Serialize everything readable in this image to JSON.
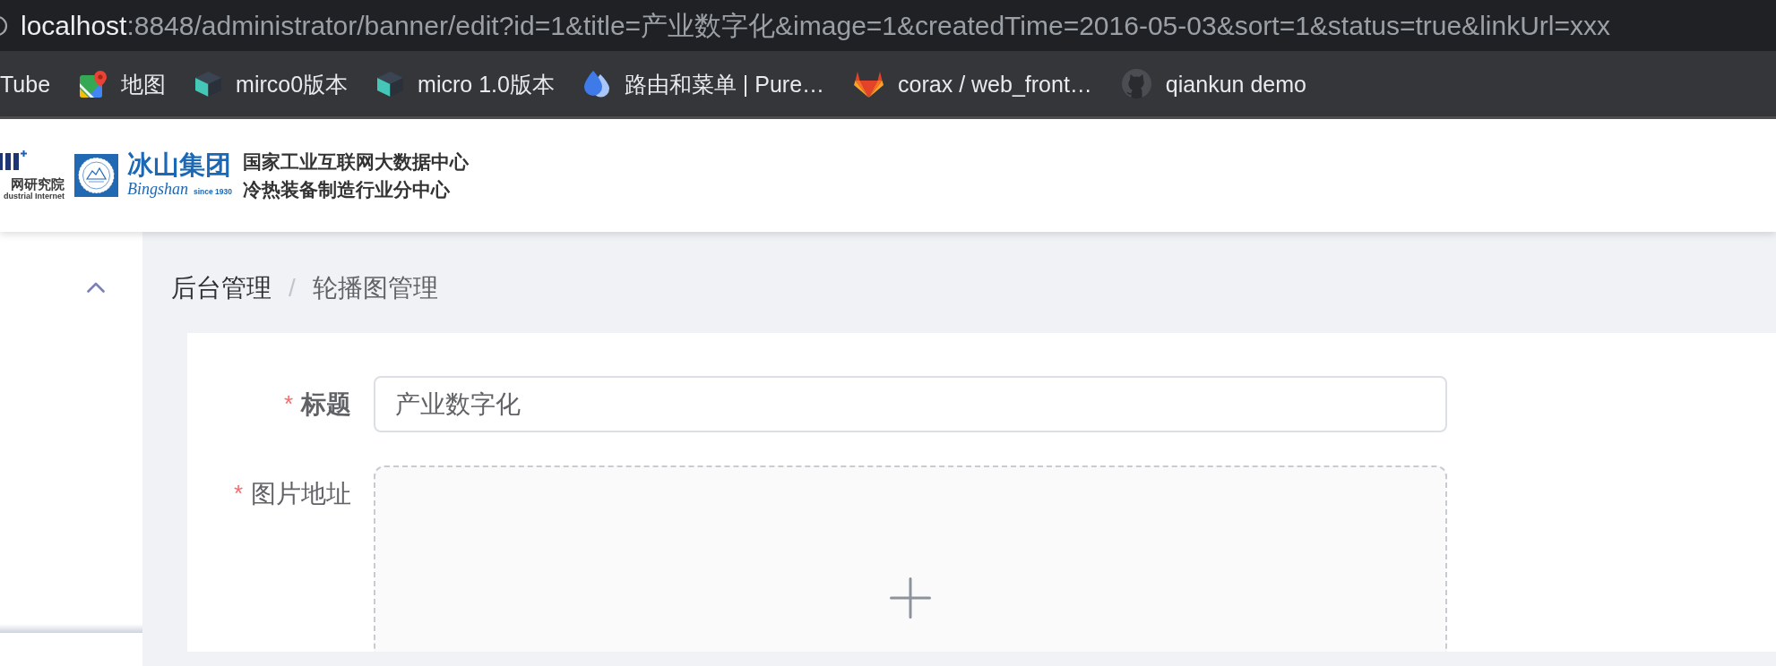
{
  "address_bar": {
    "host": "localhost",
    "rest": ":8848/administrator/banner/edit?id=1&title=产业数字化&image=1&createdTime=2016-05-03&sort=1&status=true&linkUrl=xxx"
  },
  "bookmarks": [
    {
      "kind": "plain",
      "label": "Tube"
    },
    {
      "kind": "map",
      "label": "地图"
    },
    {
      "kind": "cube",
      "label": "mirco0版本"
    },
    {
      "kind": "cube",
      "label": "micro 1.0版本"
    },
    {
      "kind": "droplet",
      "label": "路由和菜单 | Pure…"
    },
    {
      "kind": "fox",
      "label": "corax / web_front…"
    },
    {
      "kind": "cat",
      "label": "qiankun demo"
    }
  ],
  "header": {
    "partner_logo": {
      "name": "网研究院",
      "subtitle": "dustrial Internet"
    },
    "brand_logo": {
      "name": "冰山集团",
      "script": "Bingshan",
      "since": "since 1930"
    },
    "center_lines": [
      "国家工业互联网大数据中心",
      "冷热装备制造行业分中心"
    ]
  },
  "sidebar": {
    "expanded": true
  },
  "breadcrumb": {
    "items": [
      {
        "label": "后台管理",
        "current": false
      },
      {
        "label": "轮播图管理",
        "current": true
      }
    ],
    "separator": "/"
  },
  "form": {
    "fields": [
      {
        "kind": "text",
        "required_mark": "*",
        "label": "标题",
        "value": "产业数字化"
      },
      {
        "kind": "upload",
        "required_mark": "*",
        "label": "图片地址"
      }
    ]
  }
}
